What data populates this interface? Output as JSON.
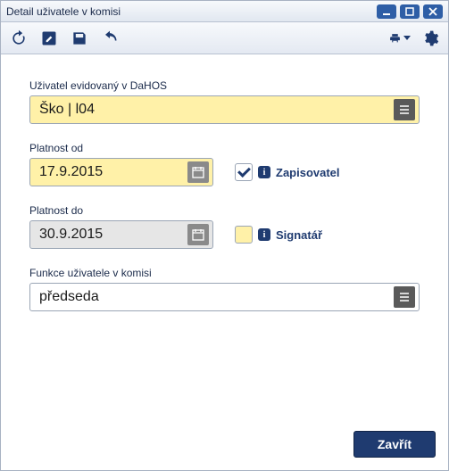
{
  "window": {
    "title": "Detail uživatele v komisi"
  },
  "form": {
    "user_label": "Uživatel evidovaný v DaHOS",
    "user_value": "Ško | l04",
    "valid_from_label": "Platnost od",
    "valid_from_value": "17.9.2015",
    "valid_to_label": "Platnost do",
    "valid_to_value": "30.9.2015",
    "function_label": "Funkce uživatele v komisi",
    "function_value": "předseda"
  },
  "checks": {
    "recorder_label": "Zapisovatel",
    "recorder_checked": true,
    "signatory_label": "Signatář",
    "signatory_checked": false
  },
  "buttons": {
    "close": "Zavřít"
  },
  "icons": {
    "refresh": "refresh-icon",
    "edit": "edit-icon",
    "save": "save-icon",
    "undo": "undo-icon",
    "print": "print-icon",
    "settings": "gear-icon",
    "lookup": "list-icon",
    "calendar": "calendar-icon",
    "info": "i"
  },
  "colors": {
    "primary": "#1f3b70",
    "highlight": "#fff1a8",
    "disabled": "#e6e6e6"
  }
}
